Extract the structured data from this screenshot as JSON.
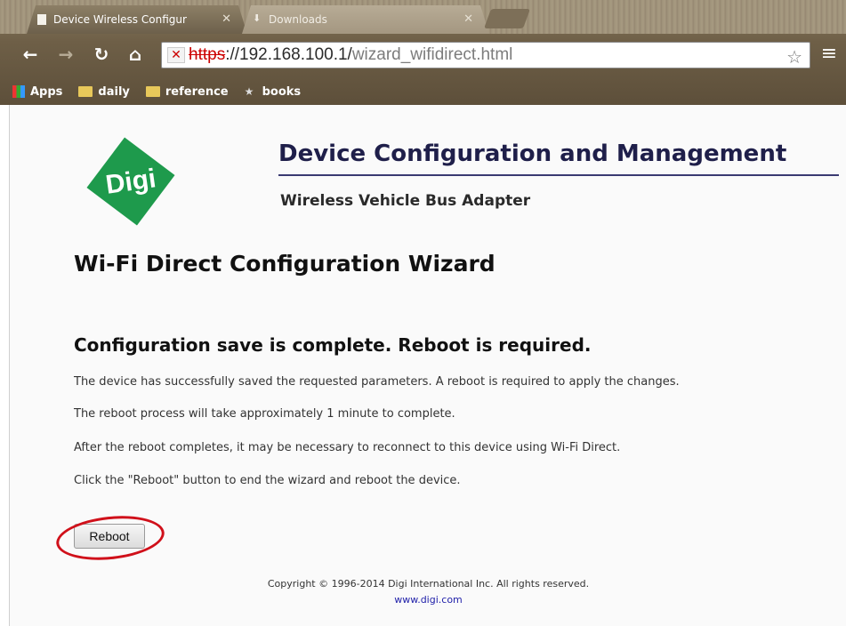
{
  "browser": {
    "tabs": [
      {
        "label": "Device Wireless Configur",
        "active": true
      },
      {
        "label": "Downloads",
        "active": false
      }
    ],
    "url": {
      "scheme": "https",
      "host": "://192.168.100.1/",
      "path": "wizard_wifidirect.html"
    },
    "bookmarks": [
      {
        "label": "Apps",
        "icon": "apps-icon"
      },
      {
        "label": "daily",
        "icon": "folder-icon"
      },
      {
        "label": "reference",
        "icon": "folder-icon"
      },
      {
        "label": "books",
        "icon": "bookmark-icon"
      }
    ]
  },
  "header": {
    "logo_text": "Digi",
    "title": "Device Configuration and Management",
    "subtitle": "Wireless Vehicle Bus Adapter"
  },
  "wizard": {
    "title": "Wi-Fi Direct Configuration Wizard",
    "status_title": "Configuration save is complete. Reboot is required.",
    "paragraphs": [
      "The device has successfully saved the requested parameters. A reboot is required to apply the changes.",
      "The reboot process will take approximately 1 minute to complete.",
      "After the reboot completes, it may be necessary to reconnect to this device using Wi-Fi Direct.",
      "Click the \"Reboot\" button to end the wizard and reboot the device."
    ],
    "reboot_label": "Reboot"
  },
  "footer": {
    "copyright": "Copyright © 1996-2014 Digi International Inc. All rights reserved.",
    "link": "www.digi.com"
  },
  "colors": {
    "logo_green": "#1e9a4c",
    "highlight_red": "#d0101a",
    "header_rule": "#3a3a72"
  }
}
